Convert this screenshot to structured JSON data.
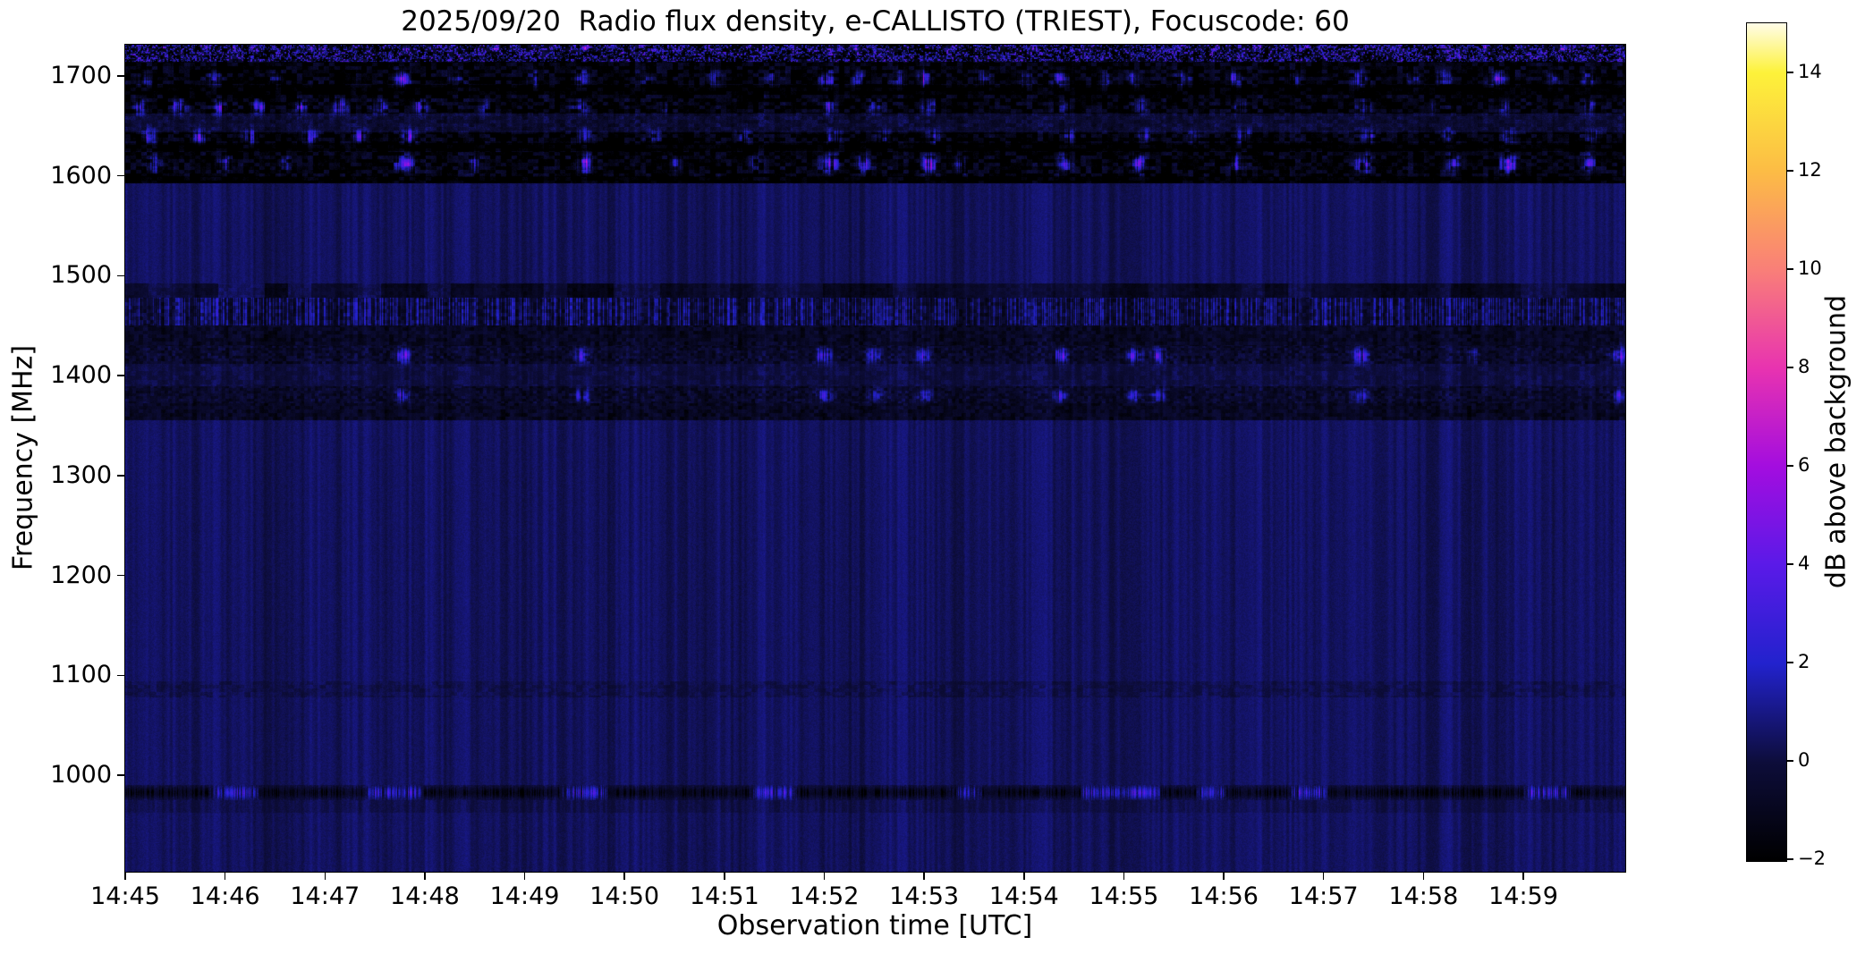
{
  "chart_data": {
    "type": "heatmap",
    "subtype": "radio-spectrogram",
    "title": "2025/09/20  Radio flux density, e-CALLISTO (TRIEST), Focuscode: 60",
    "xlabel": "Observation time [UTC]",
    "ylabel": "Frequency [MHz]",
    "colorbar_label": "dB above background",
    "x_ticks": [
      "14:45",
      "14:46",
      "14:47",
      "14:48",
      "14:49",
      "14:50",
      "14:51",
      "14:52",
      "14:53",
      "14:54",
      "14:55",
      "14:56",
      "14:57",
      "14:58",
      "14:59"
    ],
    "y_ticks": [
      "1700",
      "1600",
      "1500",
      "1400",
      "1300",
      "1200",
      "1100",
      "1000"
    ],
    "y_tick_values": [
      1700,
      1600,
      1500,
      1400,
      1300,
      1200,
      1100,
      1000
    ],
    "colorbar_ticks": [
      {
        "v": 14,
        "label": "14"
      },
      {
        "v": 12,
        "label": "12"
      },
      {
        "v": 10,
        "label": "10"
      },
      {
        "v": 8,
        "label": "8"
      },
      {
        "v": 6,
        "label": "6"
      },
      {
        "v": 4,
        "label": "4"
      },
      {
        "v": 2,
        "label": "2"
      },
      {
        "v": 0,
        "label": "0"
      },
      {
        "v": -2,
        "label": "−2"
      }
    ],
    "time_start_utc": "14:45",
    "time_end_utc": "15:00",
    "time_span_min": 15.02,
    "freq_range_mhz": [
      903.3,
      1731.3
    ],
    "value_range_db": [
      -2,
      15
    ],
    "grid": false,
    "legend": "colorbar-right",
    "colormap": {
      "name": "gnuplot2-like (black-blue-violet-magenta-pink-orange-yellow-white)",
      "stops": [
        {
          "db": -2,
          "rgb": [
            0,
            0,
            0
          ]
        },
        {
          "db": 0,
          "rgb": [
            13,
            13,
            58
          ]
        },
        {
          "db": 2,
          "rgb": [
            34,
            34,
            205
          ]
        },
        {
          "db": 4,
          "rgb": [
            90,
            26,
            232
          ]
        },
        {
          "db": 6,
          "rgb": [
            163,
            13,
            223
          ]
        },
        {
          "db": 8,
          "rgb": [
            232,
            51,
            176
          ]
        },
        {
          "db": 10,
          "rgb": [
            249,
            127,
            120
          ]
        },
        {
          "db": 12,
          "rgb": [
            252,
            188,
            69
          ]
        },
        {
          "db": 14,
          "rgb": [
            253,
            242,
            58
          ]
        },
        {
          "db": 15,
          "rgb": [
            255,
            252,
            232
          ]
        }
      ]
    },
    "features": {
      "background_level_db": 1.25,
      "bands": [
        {
          "name": "upper-rfi-band",
          "freq_range": [
            1593,
            1731
          ],
          "description": "dense black/blue mottle with bright burst stripes"
        },
        {
          "name": "upper-blue-lane",
          "freq_range": [
            1644,
            1662
          ],
          "description": "smooth brighter blue lane"
        },
        {
          "name": "upper-dark-lanes",
          "freq_ranges": [
            [
              1681,
              1691
            ],
            [
              1625,
              1633
            ]
          ],
          "description": "dark lanes"
        },
        {
          "name": "mid-rfi-band",
          "freq_range": [
            1355,
            1492
          ],
          "description": "textured band with blocky segments, streaks and burst lines at 1420/1380 MHz"
        },
        {
          "name": "low-rfi-line",
          "freq_range": [
            975,
            990
          ],
          "center_mhz": 982.5,
          "description": "dark line with periodic violet-blue blobs"
        },
        {
          "name": "faint-band",
          "freq_range": [
            1078,
            1094
          ],
          "description": "very subtle speckle band"
        }
      ],
      "burst_stripes": [
        {
          "name": "stripe-1728",
          "center_mhz": 1728,
          "halfwidth_mhz": 3,
          "sigma_min": 0.035,
          "bursts": [
            [
              0.4,
              6
            ],
            [
              1.1,
              7
            ],
            [
              2.0,
              6
            ],
            [
              2.8,
              8
            ],
            [
              3.7,
              6
            ],
            [
              4.6,
              8
            ],
            [
              5.5,
              6
            ],
            [
              6.4,
              7
            ],
            [
              7.3,
              8
            ],
            [
              8.2,
              7
            ],
            [
              9.1,
              6
            ],
            [
              10.0,
              7
            ],
            [
              10.9,
              6
            ],
            [
              11.8,
              7
            ],
            [
              12.7,
              8
            ],
            [
              13.6,
              6
            ],
            [
              14.4,
              7
            ]
          ]
        },
        {
          "name": "stripe-1697",
          "center_mhz": 1697,
          "halfwidth_mhz": 8,
          "sigma_min": 0.07,
          "bursts": [
            [
              0.2,
              6
            ],
            [
              0.9,
              5
            ],
            [
              1.5,
              6
            ],
            [
              2.78,
              13
            ],
            [
              3.3,
              5
            ],
            [
              4.1,
              5
            ],
            [
              4.58,
              11
            ],
            [
              5.2,
              5
            ],
            [
              5.9,
              6
            ],
            [
              6.5,
              5
            ],
            [
              7.02,
              10
            ],
            [
              7.35,
              8
            ],
            [
              7.75,
              6
            ],
            [
              8.0,
              9
            ],
            [
              8.6,
              6
            ],
            [
              9.0,
              6
            ],
            [
              9.37,
              9
            ],
            [
              9.8,
              5
            ],
            [
              10.1,
              8
            ],
            [
              10.6,
              6
            ],
            [
              11.1,
              9
            ],
            [
              11.7,
              5
            ],
            [
              12.37,
              10
            ],
            [
              12.9,
              6
            ],
            [
              13.2,
              7
            ],
            [
              13.75,
              11
            ],
            [
              14.3,
              6
            ],
            [
              14.65,
              9
            ]
          ]
        },
        {
          "name": "stripe-1669",
          "center_mhz": 1669,
          "halfwidth_mhz": 7,
          "sigma_min": 0.07,
          "bursts": [
            [
              0.15,
              9
            ],
            [
              0.55,
              10
            ],
            [
              0.95,
              9
            ],
            [
              1.35,
              10
            ],
            [
              1.75,
              9
            ],
            [
              2.15,
              10
            ],
            [
              2.55,
              9
            ],
            [
              2.95,
              8
            ],
            [
              3.6,
              5
            ],
            [
              4.55,
              8
            ],
            [
              5.4,
              5
            ],
            [
              7.05,
              9
            ],
            [
              7.5,
              6
            ],
            [
              8.05,
              8
            ],
            [
              9.4,
              7
            ],
            [
              10.15,
              8
            ],
            [
              11.15,
              7
            ],
            [
              12.4,
              8
            ],
            [
              13.1,
              5
            ],
            [
              13.8,
              8
            ],
            [
              14.65,
              7
            ]
          ]
        },
        {
          "name": "stripe-1639",
          "center_mhz": 1639,
          "halfwidth_mhz": 7,
          "sigma_min": 0.07,
          "bursts": [
            [
              0.25,
              9
            ],
            [
              0.75,
              10
            ],
            [
              1.25,
              9
            ],
            [
              1.85,
              10
            ],
            [
              2.35,
              9
            ],
            [
              2.85,
              9
            ],
            [
              4.6,
              9
            ],
            [
              5.3,
              6
            ],
            [
              6.2,
              5
            ],
            [
              7.1,
              8
            ],
            [
              7.6,
              6
            ],
            [
              8.1,
              7
            ],
            [
              9.45,
              7
            ],
            [
              10.2,
              7
            ],
            [
              10.7,
              5
            ],
            [
              11.2,
              7
            ],
            [
              12.45,
              7
            ],
            [
              13.25,
              6
            ],
            [
              13.85,
              7
            ],
            [
              14.7,
              7
            ]
          ]
        },
        {
          "name": "stripe-1612",
          "center_mhz": 1612,
          "halfwidth_mhz": 9,
          "sigma_min": 0.08,
          "bursts": [
            [
              0.3,
              6
            ],
            [
              1.0,
              6
            ],
            [
              1.6,
              5
            ],
            [
              2.8,
              13
            ],
            [
              3.5,
              5
            ],
            [
              4.6,
              12
            ],
            [
              5.5,
              5
            ],
            [
              6.3,
              5
            ],
            [
              7.05,
              12
            ],
            [
              7.4,
              9
            ],
            [
              8.05,
              11
            ],
            [
              8.35,
              8
            ],
            [
              9.4,
              8
            ],
            [
              10.15,
              9
            ],
            [
              11.15,
              8
            ],
            [
              12.4,
              10
            ],
            [
              13.3,
              7
            ],
            [
              13.85,
              10
            ],
            [
              14.65,
              8
            ]
          ]
        },
        {
          "name": "stripe-1420",
          "center_mhz": 1420,
          "halfwidth_mhz": 7,
          "sigma_min": 0.07,
          "bursts": [
            [
              2.78,
              10
            ],
            [
              4.58,
              9
            ],
            [
              7.0,
              10
            ],
            [
              7.5,
              8
            ],
            [
              8.0,
              8
            ],
            [
              9.37,
              9
            ],
            [
              10.1,
              8
            ],
            [
              10.35,
              8
            ],
            [
              12.37,
              8
            ],
            [
              13.5,
              4
            ],
            [
              14.95,
              9
            ]
          ]
        },
        {
          "name": "stripe-1380",
          "center_mhz": 1380,
          "halfwidth_mhz": 6,
          "sigma_min": 0.07,
          "bursts": [
            [
              2.78,
              8
            ],
            [
              4.58,
              7
            ],
            [
              7.0,
              8
            ],
            [
              7.5,
              6
            ],
            [
              8.0,
              6
            ],
            [
              9.37,
              7
            ],
            [
              10.1,
              6
            ],
            [
              10.35,
              6
            ],
            [
              12.37,
              6
            ],
            [
              14.95,
              7
            ]
          ]
        }
      ],
      "low_line_blobs_min": [
        [
          0.9,
          1.3,
          5
        ],
        [
          2.45,
          2.95,
          5
        ],
        [
          4.4,
          4.8,
          5.5
        ],
        [
          6.3,
          6.7,
          5
        ],
        [
          8.3,
          8.55,
          4
        ],
        [
          9.6,
          10.35,
          6
        ],
        [
          10.75,
          11.0,
          5
        ],
        [
          11.7,
          12.0,
          5
        ],
        [
          14.05,
          14.45,
          5.5
        ]
      ]
    }
  }
}
